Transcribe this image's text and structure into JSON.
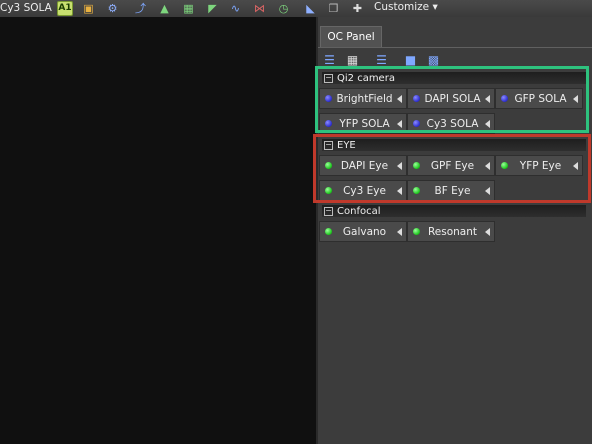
{
  "toolbar": {
    "title": "Cy3 SOLA",
    "a1_label": "A1",
    "customize_label": "Customize ▾",
    "icons": [
      "a1-icon",
      "folder-icon",
      "settings-icon",
      "measure-icon",
      "layers-icon",
      "export-icon",
      "wave-icon",
      "split-icon",
      "timer-icon",
      "chart-icon",
      "windows-icon",
      "stage-icon"
    ]
  },
  "panel": {
    "tab_label": "OC Panel",
    "groups": [
      {
        "title": "Qi2 camera",
        "dot": "blue",
        "buttons": [
          "BrightField",
          "DAPI SOLA",
          "GFP SOLA",
          "YFP SOLA",
          "Cy3 SOLA"
        ]
      },
      {
        "title": "EYE",
        "dot": "green",
        "buttons": [
          "DAPI Eye",
          "GPF Eye",
          "YFP Eye",
          "Cy3 Eye",
          "BF Eye"
        ]
      },
      {
        "title": "Confocal",
        "dot": "green",
        "buttons": [
          "Galvano",
          "Resonant"
        ]
      }
    ]
  },
  "highlights": {
    "qi2_color": "#2ec27e",
    "eye_color": "#c0392b"
  }
}
